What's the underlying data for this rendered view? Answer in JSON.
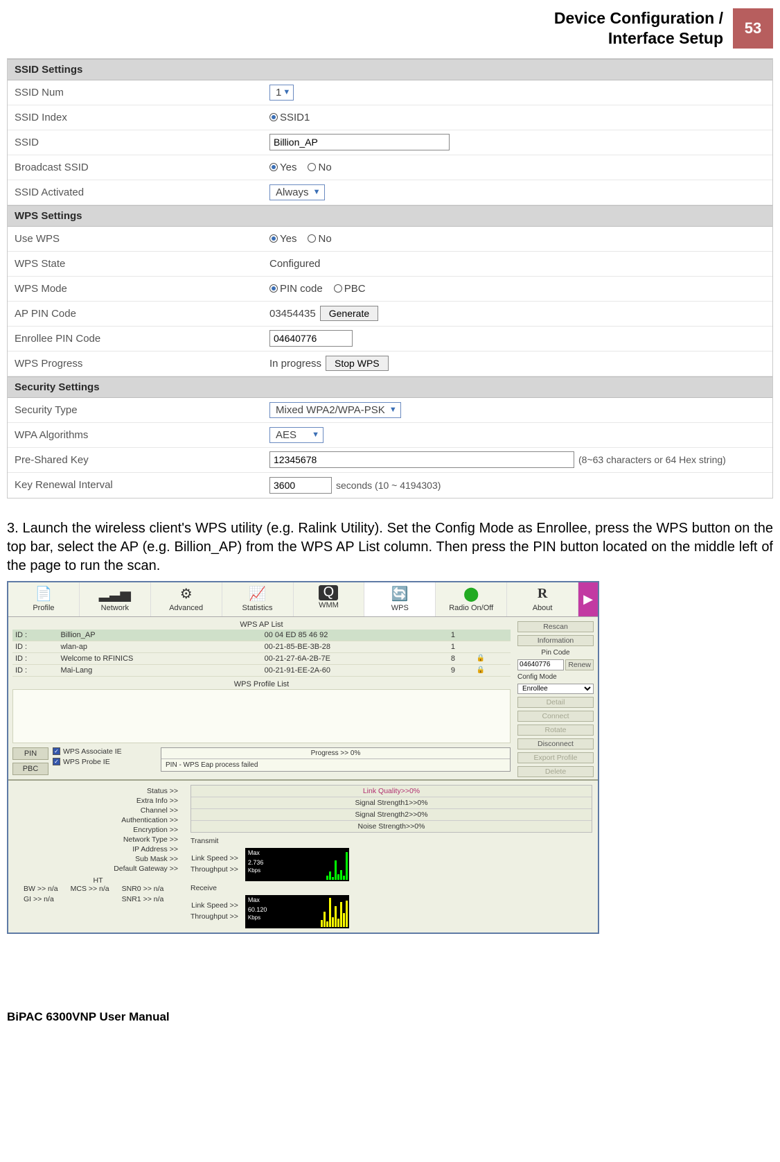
{
  "header": {
    "title_line1": "Device Configuration /",
    "title_line2": "Interface Setup",
    "page_number": "53"
  },
  "router": {
    "sections": {
      "ssid_settings": "SSID Settings",
      "wps_settings": "WPS Settings",
      "security_settings": "Security Settings"
    },
    "ssid_num": {
      "label": "SSID Num",
      "value": "1"
    },
    "ssid_index": {
      "label": "SSID Index",
      "option": "SSID1"
    },
    "ssid": {
      "label": "SSID",
      "value": "Billion_AP"
    },
    "broadcast_ssid": {
      "label": "Broadcast SSID",
      "yes": "Yes",
      "no": "No"
    },
    "ssid_activated": {
      "label": "SSID Activated",
      "value": "Always"
    },
    "use_wps": {
      "label": "Use WPS",
      "yes": "Yes",
      "no": "No"
    },
    "wps_state": {
      "label": "WPS State",
      "value": "Configured"
    },
    "wps_mode": {
      "label": "WPS Mode",
      "pin": "PIN code",
      "pbc": "PBC"
    },
    "ap_pin_code": {
      "label": "AP PIN Code",
      "value": "03454435",
      "button": "Generate"
    },
    "enrollee_pin": {
      "label": "Enrollee PIN Code",
      "value": "04640776"
    },
    "wps_progress": {
      "label": "WPS Progress",
      "value": "In progress",
      "button": "Stop WPS"
    },
    "security_type": {
      "label": "Security Type",
      "value": "Mixed WPA2/WPA-PSK"
    },
    "wpa_algorithms": {
      "label": "WPA Algorithms",
      "value": "AES"
    },
    "psk": {
      "label": "Pre-Shared Key",
      "value": "12345678",
      "hint": "(8~63 characters or 64 Hex string)"
    },
    "key_renewal": {
      "label": "Key Renewal Interval",
      "value": "3600",
      "unit": "seconds   (10 ~ 4194303)"
    }
  },
  "step3": "3. Launch the wireless client's WPS utility (e.g. Ralink Utility). Set the Config Mode as Enrollee, press the WPS button on the top bar, select the AP (e.g. Billion_AP) from the WPS AP List column. Then press the PIN button located on the middle left of the page to run the scan.",
  "ralink": {
    "toolbar": {
      "items": [
        {
          "label": "Profile",
          "icon": "📄"
        },
        {
          "label": "Network",
          "icon": "📶"
        },
        {
          "label": "Advanced",
          "icon": "⚙"
        },
        {
          "label": "Statistics",
          "icon": "📊"
        },
        {
          "label": "WMM",
          "icon": "◑"
        },
        {
          "label": "WPS",
          "icon": "↻"
        },
        {
          "label": "Radio On/Off",
          "icon": "⬤"
        },
        {
          "label": "About",
          "icon": "R"
        }
      ]
    },
    "ap_list_title": "WPS AP List",
    "profile_list_title": "WPS Profile List",
    "ap_list": [
      {
        "id": "ID :",
        "ssid": "Billion_AP",
        "bssid": "00 04 ED 85 46 92",
        "ch": "1",
        "sec": ""
      },
      {
        "id": "ID :",
        "ssid": "wlan-ap",
        "bssid": "00-21-85-BE-3B-28",
        "ch": "1",
        "sec": ""
      },
      {
        "id": "ID :",
        "ssid": "Welcome to RFINICS",
        "bssid": "00-21-27-6A-2B-7E",
        "ch": "8",
        "sec": "🔒"
      },
      {
        "id": "ID :",
        "ssid": "Mai-Lang",
        "bssid": "00-21-91-EE-2A-60",
        "ch": "9",
        "sec": "🔒"
      }
    ],
    "side": {
      "rescan": "Rescan",
      "information": "Information",
      "pin_code_label": "Pin Code",
      "pin_code_value": "04640776",
      "renew": "Renew",
      "config_mode_label": "Config Mode",
      "config_mode_value": "Enrollee",
      "detail": "Detail",
      "connect": "Connect",
      "rotate": "Rotate",
      "disconnect": "Disconnect",
      "export_profile": "Export Profile",
      "delete": "Delete"
    },
    "pin_area": {
      "pin": "PIN",
      "pbc": "PBC",
      "wps_associate_ie": "WPS Associate IE",
      "wps_probe_ie": "WPS Probe IE",
      "progress_label": "Progress >> 0%",
      "status_msg": "PIN - WPS Eap process failed"
    },
    "linkinfo": {
      "left_labels": [
        "Status >>",
        "Extra Info >>",
        "Channel >>",
        "Authentication >>",
        "Encryption >>",
        "Network Type >>",
        "IP Address >>",
        "Sub Mask >>",
        "Default Gateway >>"
      ],
      "ht_label": "HT",
      "ht_rows": {
        "bw": "BW >> n/a",
        "gi": "GI >> n/a",
        "mcs": "MCS >> n/a",
        "snr0": "SNR0 >> n/a",
        "snr1": "SNR1 >> n/a"
      },
      "quality": {
        "link": "Link Quality>>0%",
        "s1": "Signal Strength1>>0%",
        "s2": "Signal Strength2>>0%",
        "noise": "Noise Strength>>0%"
      },
      "transmit_label": "Transmit",
      "receive_label": "Receive",
      "link_speed": "Link Speed >>",
      "throughput": "Throughput >>",
      "graph_tx": {
        "max": "Max",
        "val": "2.736",
        "unit": "Kbps"
      },
      "graph_rx": {
        "max": "Max",
        "val": "60.120",
        "unit": "Kbps"
      }
    }
  },
  "footer": "BiPAC 6300VNP User Manual"
}
